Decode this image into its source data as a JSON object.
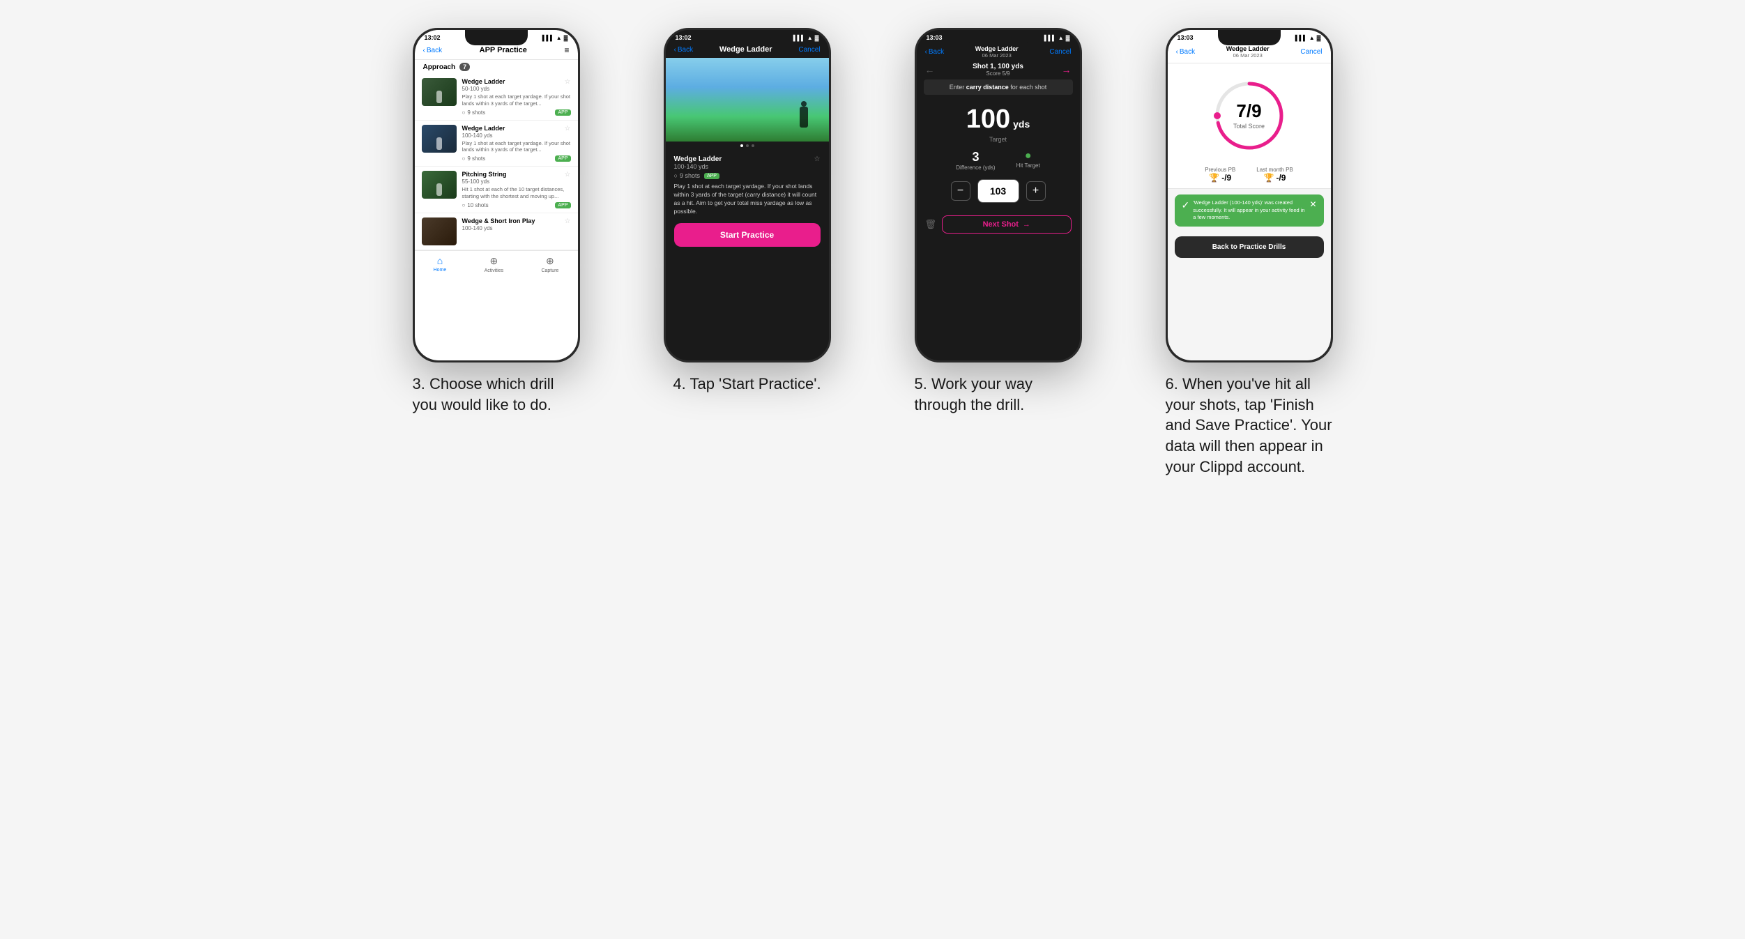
{
  "page": {
    "background": "#f5f5f5"
  },
  "phone1": {
    "status_time": "13:02",
    "nav_back": "Back",
    "nav_title": "APP Practice",
    "approach_label": "Approach",
    "approach_count": "7",
    "drills": [
      {
        "name": "Wedge Ladder",
        "range": "50-100 yds",
        "desc": "Play 1 shot at each target yardage. If your shot lands within 3 yards of the target...",
        "shots": "9 shots",
        "has_app": true
      },
      {
        "name": "Wedge Ladder",
        "range": "100-140 yds",
        "desc": "Play 1 shot at each target yardage. If your shot lands within 3 yards of the target...",
        "shots": "9 shots",
        "has_app": true
      },
      {
        "name": "Pitching String",
        "range": "55-100 yds",
        "desc": "Hit 1 shot at each of the 10 target distances, starting with the shortest and moving up...",
        "shots": "10 shots",
        "has_app": true
      },
      {
        "name": "Wedge & Short Iron Play",
        "range": "100-140 yds",
        "desc": "",
        "shots": "",
        "has_app": false
      }
    ],
    "bottom_nav": [
      "Home",
      "Activities",
      "Capture"
    ],
    "caption": "3. Choose which drill you would like to do."
  },
  "phone2": {
    "status_time": "13:02",
    "nav_back": "Back",
    "nav_title": "Wedge Ladder",
    "nav_cancel": "Cancel",
    "card_title": "Wedge Ladder",
    "card_range": "100-140 yds",
    "card_shots": "9 shots",
    "card_desc": "Play 1 shot at each target yardage. If your shot lands within 3 yards of the target (carry distance) it will count as a hit. Aim to get your total miss yardage as low as possible.",
    "start_btn": "Start Practice",
    "caption": "4. Tap 'Start Practice'."
  },
  "phone3": {
    "status_time": "13:03",
    "nav_back": "Back",
    "nav_title": "Wedge Ladder",
    "nav_date": "06 Mar 2023",
    "nav_cancel": "Cancel",
    "shot_title": "Shot 1, 100 yds",
    "score_label": "Score 5/9",
    "carry_prompt": "Enter carry distance for each shot",
    "carry_keyword": "carry",
    "target_yds": "100",
    "target_unit": "yds",
    "target_label": "Target",
    "difference": "3",
    "difference_label": "Difference (yds)",
    "hit_target_label": "Hit Target",
    "input_value": "103",
    "next_shot_btn": "Next Shot",
    "caption": "5. Work your way through the drill."
  },
  "phone4": {
    "status_time": "13:03",
    "nav_back": "Back",
    "nav_title": "Wedge Ladder",
    "nav_date": "06 Mar 2023",
    "nav_cancel": "Cancel",
    "score_main": "7/9",
    "score_sub": "Total Score",
    "prev_pb_label": "Previous PB",
    "prev_pb_value": "-/9",
    "last_pb_label": "Last month PB",
    "last_pb_value": "-/9",
    "success_msg": "'Wedge Ladder (100-140 yds)' was created successfully. It will appear in your activity feed in a few moments.",
    "back_btn": "Back to Practice Drills",
    "caption": "6. When you've hit all your shots, tap 'Finish and Save Practice'. Your data will then appear in your Clippd account."
  }
}
